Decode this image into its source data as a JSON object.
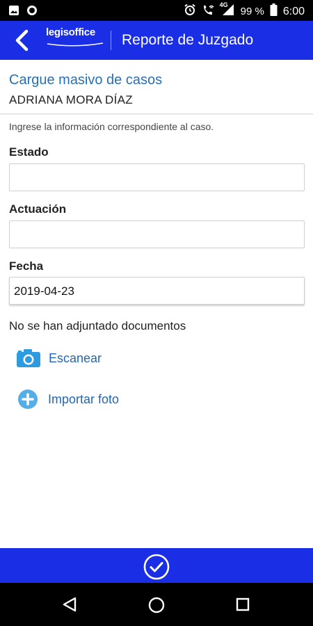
{
  "status_bar": {
    "battery_text": "99 %",
    "time": "6:00",
    "network": "4G",
    "icons": [
      "image-icon",
      "circle-icon",
      "alarm-icon",
      "phone-wifi-icon",
      "signal-icon",
      "battery-icon"
    ]
  },
  "app_bar": {
    "brand": "legisoffice",
    "title": "Reporte de Juzgado"
  },
  "header": {
    "case_title": "Cargue masivo de casos",
    "person": "ADRIANA MORA DÍAZ"
  },
  "instructions": "Ingrese la información correspondiente al caso.",
  "form": {
    "estado": {
      "label": "Estado",
      "value": "",
      "placeholder": ""
    },
    "actuacion": {
      "label": "Actuación",
      "value": "",
      "placeholder": ""
    },
    "fecha": {
      "label": "Fecha",
      "value": "2019-04-23",
      "placeholder": ""
    }
  },
  "attachments": {
    "empty_text": "No se han adjuntado documentos",
    "scan_label": "Escanear",
    "import_label": "Importar foto"
  },
  "colors": {
    "brand_blue": "#1a2ee6",
    "link_blue": "#2266b5",
    "title_blue": "#2870b3",
    "icon_blue": "#2d9be0"
  }
}
